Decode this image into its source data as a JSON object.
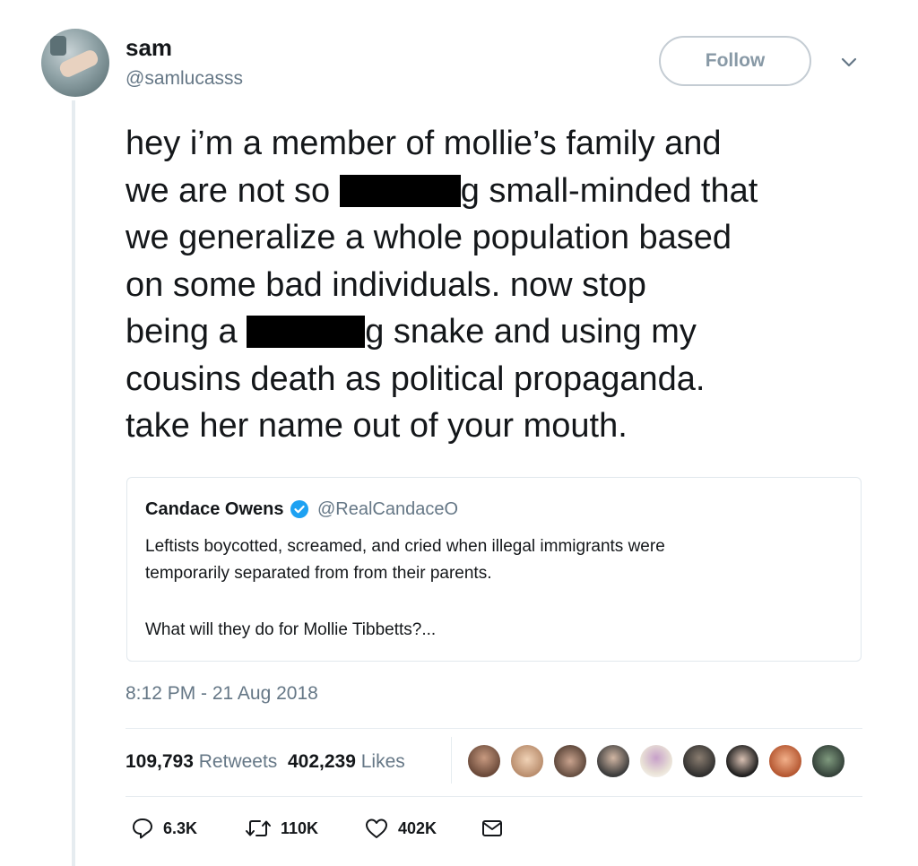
{
  "author": {
    "name": "sam",
    "handle": "@samlucasss"
  },
  "follow_label": "Follow",
  "tweet": {
    "line1": "hey i’m a member of mollie’s family and",
    "line2a": "we are not so ",
    "line2b": "g small-minded that",
    "line3": "we generalize a whole population based",
    "line4": "on some bad individuals. now stop",
    "line5a": "being a ",
    "line5b": "g snake and using my",
    "line6": "cousins death as political propaganda.",
    "line7": "take her name out of your mouth."
  },
  "quoted": {
    "name": "Candace Owens",
    "handle": "@RealCandaceO",
    "text1": "Leftists boycotted, screamed, and cried when illegal immigrants were",
    "text2": "temporarily separated from from their parents.",
    "text3": "What will they do for Mollie Tibbetts?..."
  },
  "timestamp": "8:12 PM - 21 Aug 2018",
  "stats": {
    "retweets_count": "109,793",
    "retweets_label": "Retweets",
    "likes_count": "402,239",
    "likes_label": "Likes"
  },
  "actions": {
    "replies": "6.3K",
    "retweets": "110K",
    "likes": "402K"
  },
  "colors": {
    "text": "#14171a",
    "secondary": "#657786",
    "border": "#e1e8ed",
    "verified": "#1da1f2"
  },
  "icons": [
    "reply-icon",
    "retweet-icon",
    "heart-icon",
    "message-icon",
    "verified-icon",
    "chevron-down-icon"
  ]
}
